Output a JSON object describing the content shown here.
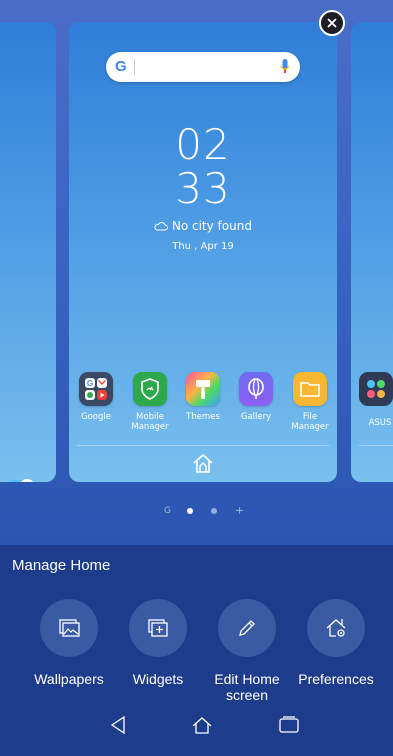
{
  "preview": {
    "search_logo": "G",
    "clock_hours": "02",
    "clock_minutes": "33",
    "weather": "No city found",
    "date": "Thu , Apr 19",
    "apps": [
      {
        "label": "Google",
        "icon": "google-folder-icon"
      },
      {
        "label": "Mobile Manager",
        "icon": "mobile-manager-icon"
      },
      {
        "label": "Themes",
        "icon": "themes-icon"
      },
      {
        "label": "Gallery",
        "icon": "gallery-icon"
      },
      {
        "label": "File Manager",
        "icon": "file-manager-icon"
      }
    ],
    "right_card_app": "ASUS"
  },
  "pagination": {
    "google_label": "G",
    "add_label": "+"
  },
  "manage": {
    "title": "Manage Home",
    "options": [
      {
        "label": "Wallpapers",
        "icon": "wallpaper-icon"
      },
      {
        "label": "Widgets",
        "icon": "widgets-icon"
      },
      {
        "label": "Edit Home screen",
        "icon": "pencil-icon"
      },
      {
        "label": "Preferences",
        "icon": "home-settings-icon"
      }
    ]
  },
  "colors": {
    "panel": "#1d3d8c",
    "card": "#3f8fe0",
    "toggle": "#4fc3f7"
  }
}
